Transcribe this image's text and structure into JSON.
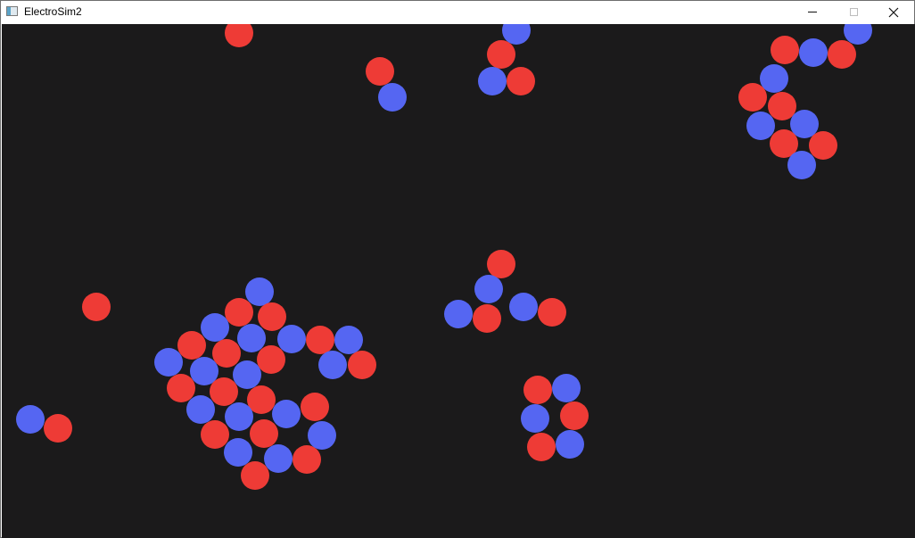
{
  "window": {
    "title": "ElectroSim2",
    "app_icon": "app-window-icon",
    "controls": {
      "minimize_icon": "minimize-icon",
      "maximize_icon": "maximize-icon",
      "close_icon": "close-icon"
    }
  },
  "colors": {
    "canvas_background": "#1b1a1b",
    "positive_particle": "#ee3b36",
    "negative_particle": "#5566f2"
  }
}
